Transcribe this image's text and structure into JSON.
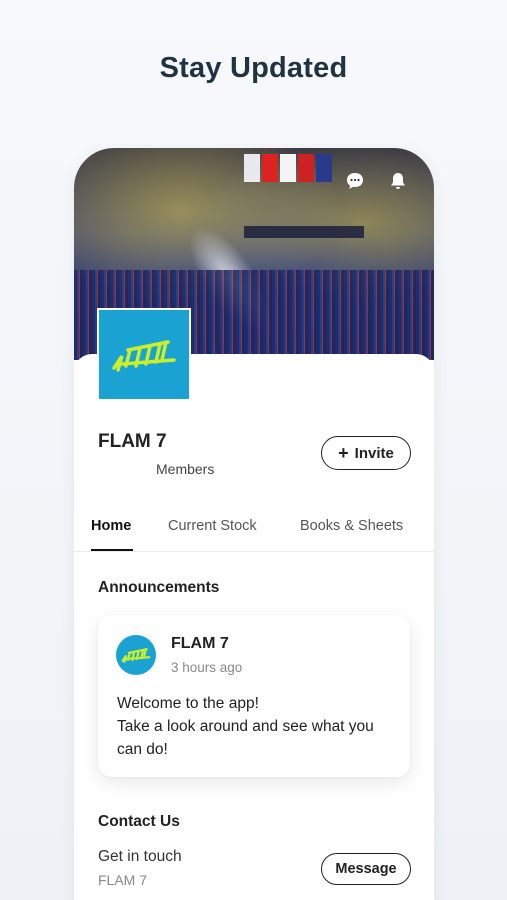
{
  "headline": "Stay Updated",
  "header": {
    "icons": [
      "chat-icon",
      "bell-icon"
    ]
  },
  "group": {
    "name": "FLAM 7",
    "members_label": "Members",
    "invite_label": "Invite",
    "invite_icon": "+"
  },
  "tabs": [
    {
      "label": "Home",
      "active": true
    },
    {
      "label": "Current Stock",
      "active": false
    },
    {
      "label": "Books & Sheets",
      "active": false
    }
  ],
  "announcements": {
    "title": "Announcements",
    "post": {
      "author": "FLAM 7",
      "time": "3 hours ago",
      "body": "Welcome to the app!\nTake a look around and see what you can do!"
    }
  },
  "contact": {
    "title": "Contact Us",
    "subtitle": "Get in touch",
    "name": "FLAM 7",
    "button_label": "Message"
  },
  "colors": {
    "brand_blue": "#1aa3d2",
    "logo_mark": "#c8ef2a",
    "headline": "#1f3340"
  }
}
